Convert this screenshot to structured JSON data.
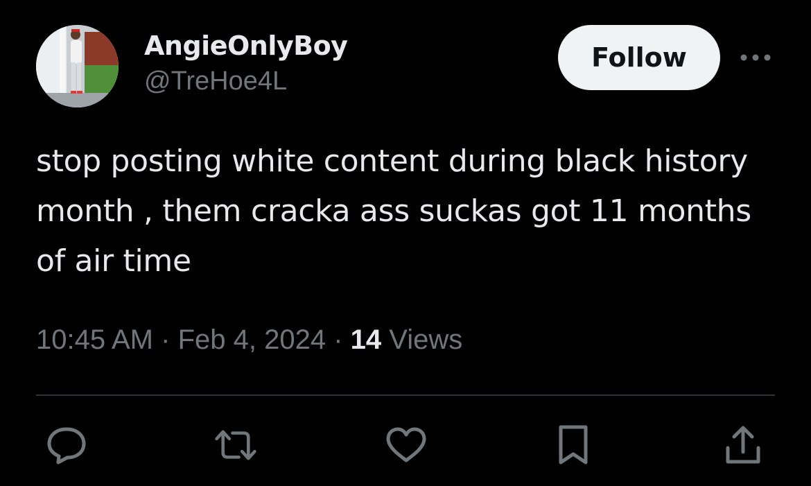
{
  "author": {
    "display_name": "AngieOnlyBoy",
    "handle": "@TreHoe4L",
    "avatar": "profile-photo"
  },
  "header": {
    "follow_label": "Follow",
    "more_icon": "more-horizontal-icon"
  },
  "tweet": {
    "text": "stop posting white content during black history month , them cracka ass suckas got 11 months of air time",
    "time": "10:45 AM",
    "separator": "·",
    "date": "Feb 4, 2024",
    "views_count": "14",
    "views_label": "Views"
  },
  "actions": {
    "icons": [
      "reply-icon",
      "retweet-icon",
      "like-icon",
      "bookmark-icon",
      "share-icon"
    ]
  },
  "colors": {
    "background": "#000000",
    "text": "#e7e9ea",
    "secondary_text": "#71767b",
    "divider": "#2f3336",
    "follow_bg": "#eff3f4"
  }
}
